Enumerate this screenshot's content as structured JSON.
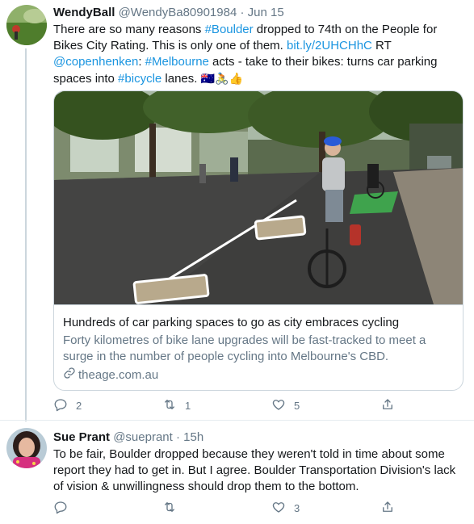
{
  "tweets": [
    {
      "name": "WendyBall",
      "handle": "@WendyBa80901984",
      "dot": "·",
      "time": "Jun 15",
      "text": {
        "p1": "There are so many reasons ",
        "h1": "#Boulder",
        "p2": " dropped to 74th on the People for Bikes City Rating. This is only one of them. ",
        "l1": "bit.ly/2UHCHhC",
        "p3": " RT ",
        "m1": "@copenhenken",
        "p4": ": ",
        "h2": "#Melbourne",
        "p5": " acts - take to their  bikes: turns car parking spaces into ",
        "h3": "#bicycle",
        "p6": " lanes. ",
        "emoji": "🇦🇺🚴👍"
      },
      "card": {
        "title": "Hundreds of car parking spaces to go as city embraces cycling",
        "description": "Forty kilometres of bike lane upgrades will be fast-tracked to meet a surge in the number of people cycling into Melbourne's CBD.",
        "domain": "theage.com.au"
      },
      "actions": {
        "replies": "2",
        "retweets": "1",
        "likes": "5"
      }
    },
    {
      "name": "Sue Prant",
      "handle": "@sueprant",
      "dot": "·",
      "time": "15h",
      "text": "To be fair, Boulder dropped because they weren't told in time about some report they had to get in. But I agree. Boulder Transportation Division's lack of vision & unwillingness should drop them to the bottom.",
      "actions": {
        "replies": "",
        "retweets": "",
        "likes": "3"
      }
    }
  ],
  "icons": [
    "reply-icon",
    "retweet-icon",
    "like-icon",
    "share-icon",
    "link-icon"
  ],
  "colors": {
    "link": "#1b95e0",
    "secondary": "#657786",
    "border": "#ccd6dd"
  }
}
